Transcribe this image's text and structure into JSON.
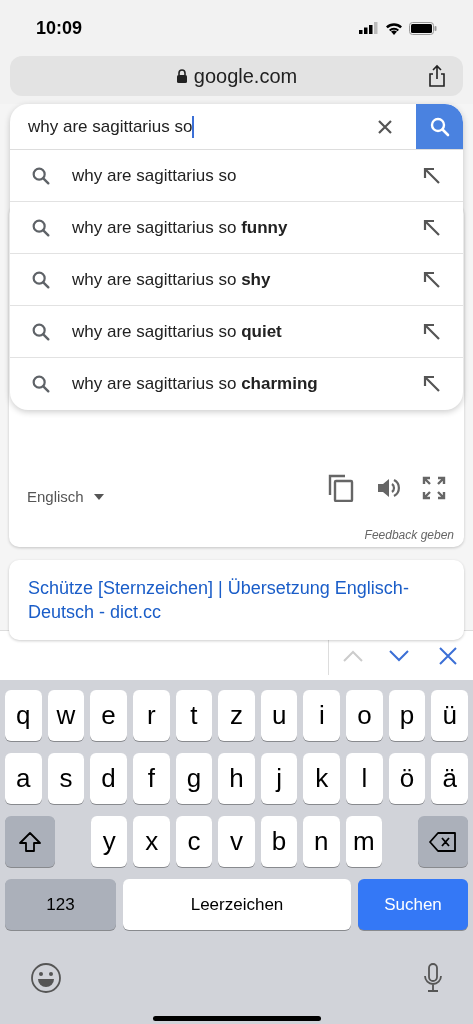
{
  "status_bar": {
    "time": "10:09"
  },
  "address_bar": {
    "url": "google.com"
  },
  "search": {
    "value": "why are sagittarius so"
  },
  "suggestions": [
    {
      "text": "why are sagittarius so"
    },
    {
      "text": "why are sagittarius so **funny**"
    },
    {
      "text": "why are sagittarius so **shy**"
    },
    {
      "text": "why are sagittarius so **quiet**"
    },
    {
      "text": "why are sagittarius so **charming**"
    }
  ],
  "translate_card": {
    "language": "Englisch",
    "feedback": "Feedback geben"
  },
  "result": {
    "title": "Schütze [Sternzeichen] | Übersetzung Englisch-Deutsch - dict.cc"
  },
  "find_bar": {
    "previous_enabled": false,
    "next_enabled": true
  },
  "keyboard": {
    "top_letters": [
      "q",
      "w",
      "e",
      "r",
      "t",
      "z",
      "u",
      "i",
      "o",
      "p",
      "ü"
    ],
    "middle_letters": [
      "a",
      "s",
      "d",
      "f",
      "g",
      "h",
      "j",
      "k",
      "l",
      "ö",
      "ä"
    ],
    "bottom_letters": [
      "y",
      "x",
      "c",
      "v",
      "b",
      "n",
      "m"
    ],
    "numbers_key": "123",
    "space_key": "Leerzeichen",
    "action_key": "Suchen"
  }
}
